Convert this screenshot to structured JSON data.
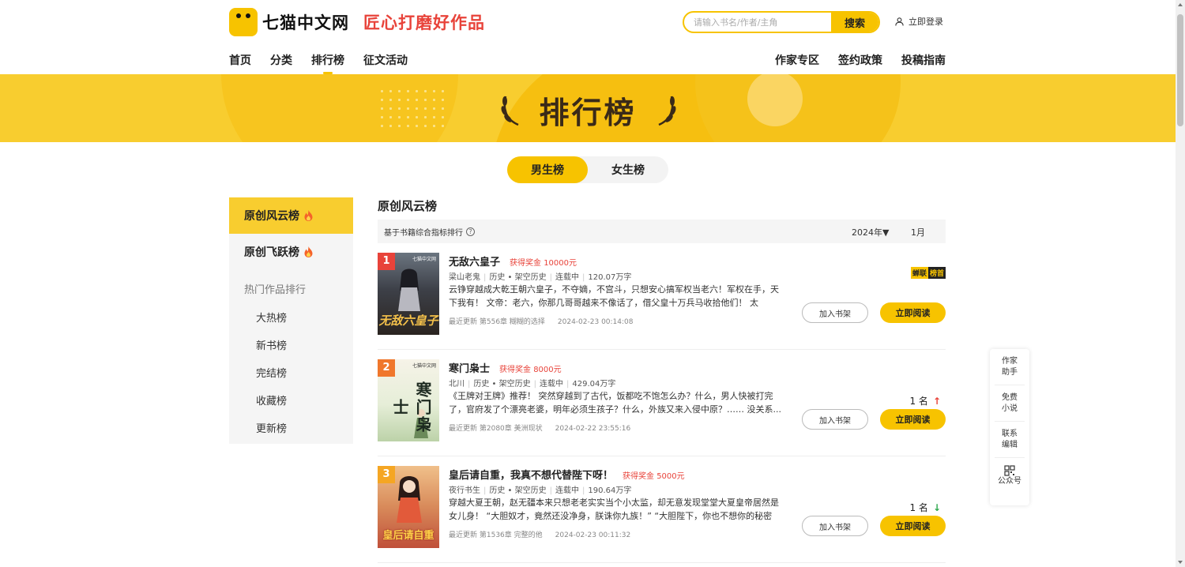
{
  "header": {
    "logo_text": "七猫中文网",
    "slogan": "匠心打磨好作品",
    "search_placeholder": "请输入书名/作者/主角",
    "search_button": "搜索",
    "login": "立即登录"
  },
  "nav": {
    "left": [
      "首页",
      "分类",
      "排行榜",
      "征文活动"
    ],
    "right": [
      "作家专区",
      "签约政策",
      "投稿指南"
    ],
    "active_index": 2
  },
  "banner": {
    "title": "排行榜"
  },
  "gender_tabs": [
    "男生榜",
    "女生榜"
  ],
  "sidebar": {
    "main": [
      "原创风云榜",
      "原创飞跃榜"
    ],
    "sub_title": "热门作品排行",
    "sub": [
      "大热榜",
      "新书榜",
      "完结榜",
      "收藏榜",
      "更新榜"
    ]
  },
  "list": {
    "title": "原创风云榜",
    "filter_text": "基于书籍综合指标排行",
    "info_icon": "?",
    "year": "2024年▼",
    "month": "1月",
    "shelf_button": "加入书架",
    "read_button": "立即阅读",
    "books": [
      {
        "rank": "1",
        "title": "无敌六皇子",
        "prize": "获得奖金  10000元",
        "author": "梁山老鬼",
        "category": "历史 • 架空历史",
        "status": "连载中",
        "words": "120.07万字",
        "desc": "云铮穿越成大乾王朝六皇子，不夺嫡，不宫斗，只想安心搞军权当老六！军权在手，天下我有！ 文帝：老六，你那几哥哥越来不像话了，借父皇十万兵马收拾他们！ 太子：...",
        "update": "最近更新 第556章 糊糊的选择",
        "time": "2024-02-23 00:14:08",
        "badge_a": "蝉联",
        "badge_b": "榜首",
        "cover_title": "无敌六皇子",
        "cover_brand": "七猫中文网"
      },
      {
        "rank": "2",
        "title": "寒门枭士",
        "prize": "获得奖金  8000元",
        "author": "北川",
        "category": "历史 • 架空历史",
        "status": "连载中",
        "words": "429.04万字",
        "desc": "《王牌对王牌》推荐！ 突然穿越到了古代，饭都吃不饱怎么办？什么，男人快被打完了，官府发了个漂亮老婆，明年必须生孩子？什么，外族又来入侵中原？…… 没关系...",
        "update": "最近更新 第2080章 美洲现状",
        "time": "2024-02-22 23:55:16",
        "rank_change": "1 名",
        "arrow": "↑",
        "cover_title": "寒门枭士",
        "cover_brand": "七猫中文网"
      },
      {
        "rank": "3",
        "title": "皇后请自重，我真不想代替陛下呀！",
        "prize": "获得奖金  5000元",
        "author": "夜行书生",
        "category": "历史 • 架空历史",
        "status": "连载中",
        "words": "190.64万字",
        "desc": "穿越大夏王朝，赵无疆本来只想老老实实当个小太监，却无意发现堂堂大夏皇帝居然是女儿身！ “大胆奴才，竟然还没净身，朕诛你九族！” “大胆陛下，你也不想你的秘密被...",
        "update": "最近更新 第1536章 完整的他",
        "time": "2024-02-23 00:11:32",
        "rank_change": "1 名",
        "arrow": "↓",
        "cover_title": "皇后请自重",
        "cover_brand": ""
      }
    ]
  },
  "float_menu": [
    [
      "作家",
      "助手"
    ],
    [
      "免费",
      "小说"
    ],
    [
      "联系",
      "编辑"
    ],
    [
      "公众号"
    ]
  ],
  "colors": {
    "brand_yellow": "#f7c300",
    "slogan_red": "#e8433a",
    "rank1": "#e8433a",
    "rank2": "#f0772c",
    "rank3": "#f5a623",
    "up_arrow": "#e8433a",
    "down_arrow": "#2ea84e"
  },
  "icons": [
    "user-icon",
    "fire-icon",
    "laurel-icon",
    "qrcode-icon",
    "info-icon"
  ]
}
